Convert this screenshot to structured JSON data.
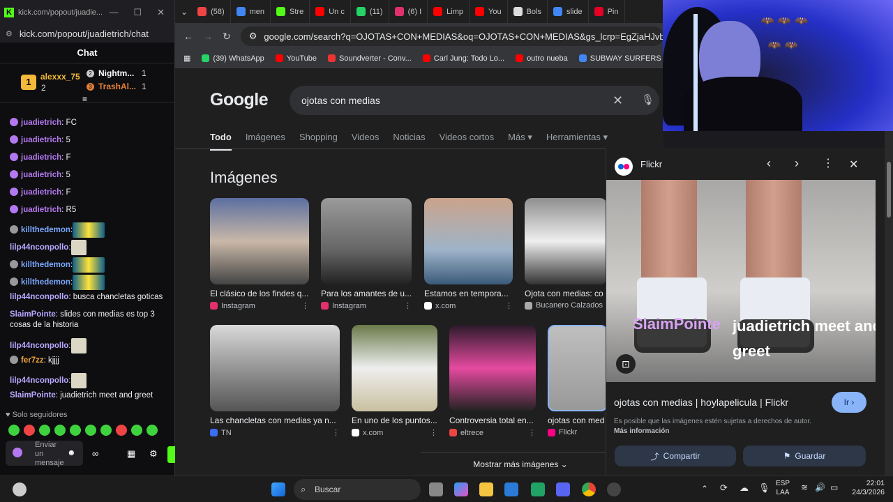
{
  "kick": {
    "window_title": "kick.com/popout/juadie...",
    "url": "kick.com/popout/juadietrich/chat",
    "chat_title": "Chat",
    "leaderboard": [
      {
        "rank": "1",
        "name": "alexxx_75",
        "count": "2"
      },
      {
        "rank": "2",
        "name": "Nightm...",
        "count": "1"
      },
      {
        "rank": "3",
        "name": "TrashAl...",
        "count": "1"
      }
    ],
    "messages": [
      {
        "user": "juadietrich",
        "text": ": FC",
        "color": "#b378f0"
      },
      {
        "user": "juadietrich",
        "text": ": 5",
        "color": "#b378f0"
      },
      {
        "user": "juadietrich",
        "text": ": F",
        "color": "#b378f0"
      },
      {
        "user": "juadietrich",
        "text": ": 5",
        "color": "#b378f0"
      },
      {
        "user": "juadietrich",
        "text": ": F",
        "color": "#b378f0"
      },
      {
        "user": "juadietrich",
        "text": ": R5",
        "color": "#b378f0"
      },
      {
        "user": "killthedemon",
        "text": ":",
        "color": "#7aa7ff"
      },
      {
        "user": "lilp44nconpollo",
        "text": ":",
        "color": "#b9a7ff"
      },
      {
        "user": "killthedemon",
        "text": ":",
        "color": "#7aa7ff"
      },
      {
        "user": "killthedemon",
        "text": ":",
        "color": "#7aa7ff"
      },
      {
        "user": "lilp44nconpollo",
        "text": ": busca chancletas goticas",
        "color": "#b9a7ff"
      },
      {
        "user": "SlaimPointe",
        "text": ": slides con medias es top 3 cosas de la historia",
        "color": "#b9a7ff"
      },
      {
        "user": "lilp44nconpollo",
        "text": ":",
        "color": "#b9a7ff"
      },
      {
        "user": "fer7zz",
        "text": ": kjjjj",
        "color": "#f0a441"
      },
      {
        "user": "lilp44nconpollo",
        "text": ":",
        "color": "#b9a7ff"
      },
      {
        "user": "SlaimPointe",
        "text": ": juadietrich meet and greet",
        "color": "#b9a7ff"
      }
    ],
    "followers_only": "Solo seguidores",
    "send_placeholder": "Enviar un mensaje"
  },
  "chrome": {
    "tabs": [
      {
        "label": "(58)",
        "color": "#e44"
      },
      {
        "label": "men",
        "color": "#4285f4"
      },
      {
        "label": "Stre",
        "color": "#53fc18"
      },
      {
        "label": "Un c",
        "color": "#f00"
      },
      {
        "label": "(11)",
        "color": "#25d366"
      },
      {
        "label": "(6) I",
        "color": "#e1306c"
      },
      {
        "label": "Limp",
        "color": "#f00"
      },
      {
        "label": "You",
        "color": "#f00"
      },
      {
        "label": "Bols",
        "color": "#ddd"
      },
      {
        "label": "slide",
        "color": "#4285f4"
      },
      {
        "label": "Pin",
        "color": "#e60023"
      }
    ],
    "url": "google.com/search?q=OJOTAS+CON+MEDIAS&oq=OJOTAS+CON+MEDIAS&gs_lcrp=EgZjaHJvbWUyCQgAEE",
    "bookmarks": [
      {
        "label": "(39) WhatsApp",
        "color": "#25d366"
      },
      {
        "label": "YouTube",
        "color": "#f00"
      },
      {
        "label": "Soundverter - Conv...",
        "color": "#e33"
      },
      {
        "label": "Carl Jung: Todo Lo...",
        "color": "#f00"
      },
      {
        "label": "outro nueba",
        "color": "#f00"
      },
      {
        "label": "SUBWAY SURFERS -...",
        "color": "#4285f4"
      }
    ]
  },
  "google": {
    "logo": "Google",
    "query": "ojotas con medias",
    "nav": [
      "Todo",
      "Imágenes",
      "Shopping",
      "Videos",
      "Noticias",
      "Videos cortos",
      "Más",
      "Herramientas"
    ],
    "section_title": "Imágenes",
    "row1": [
      {
        "title": "El clásico de los findes q...",
        "source": "Instagram",
        "scolor": "#e1306c"
      },
      {
        "title": "Para los amantes de u...",
        "source": "Instagram",
        "scolor": "#e1306c"
      },
      {
        "title": "Estamos en tempora...",
        "source": "x.com",
        "scolor": "#fff"
      },
      {
        "title": "Ojota con medias: co",
        "source": "Bucanero Calzados",
        "scolor": "#aaa"
      }
    ],
    "row2": [
      {
        "title": "Las chancletas con medias ya n...",
        "source": "TN",
        "scolor": "#3a6df0"
      },
      {
        "title": "En uno de los puntos...",
        "source": "x.com",
        "scolor": "#fff"
      },
      {
        "title": "Controversia total en...",
        "source": "eltrece",
        "scolor": "#e44"
      },
      {
        "title": "ojotas con med",
        "source": "Flickr",
        "scolor": "#ff0084"
      }
    ],
    "more_images": "Mostrar más imágenes"
  },
  "preview": {
    "source": "Flickr",
    "overlay_user": "SlaimPointe",
    "overlay_text": "juadietrich meet and greet",
    "title": "ojotas con medias | hoylapelicula | Flickr",
    "go_label": "Ir",
    "notice": "Es posible que las imágenes estén sujetas a derechos de autor.",
    "notice_link": "Más información",
    "share": "Compartir",
    "save": "Guardar"
  },
  "taskbar": {
    "search": "Buscar",
    "lang": "ESP",
    "lang2": "LAA",
    "time": "22:01",
    "date": "24/3/2026"
  }
}
